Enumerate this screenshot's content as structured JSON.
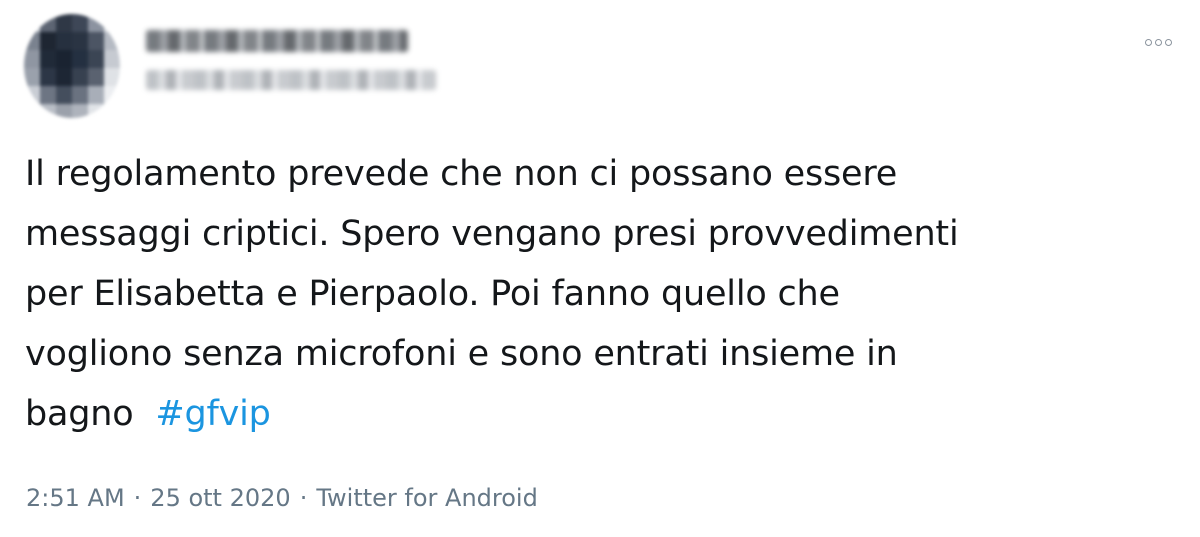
{
  "tweet": {
    "text_lines": [
      "Il regolamento prevede che non ci possano essere",
      "messaggi criptici. Spero vengano presi provvedimenti",
      "per Elisabetta e Pierpaolo. Poi fanno quello che",
      "vogliono senza microfoni e sono entrati insieme in",
      "bagno "
    ],
    "hashtag": "#gfvip",
    "time": "2:51 AM",
    "separator": "·",
    "date": "25 ott 2020",
    "source": "Twitter for Android"
  },
  "icons": {
    "more": "more-options-icon",
    "avatar": "blurred-avatar"
  },
  "colors": {
    "text": "#14171a",
    "hashtag": "#1b95e0",
    "meta": "#657786",
    "more_icon": "#8b949e"
  }
}
